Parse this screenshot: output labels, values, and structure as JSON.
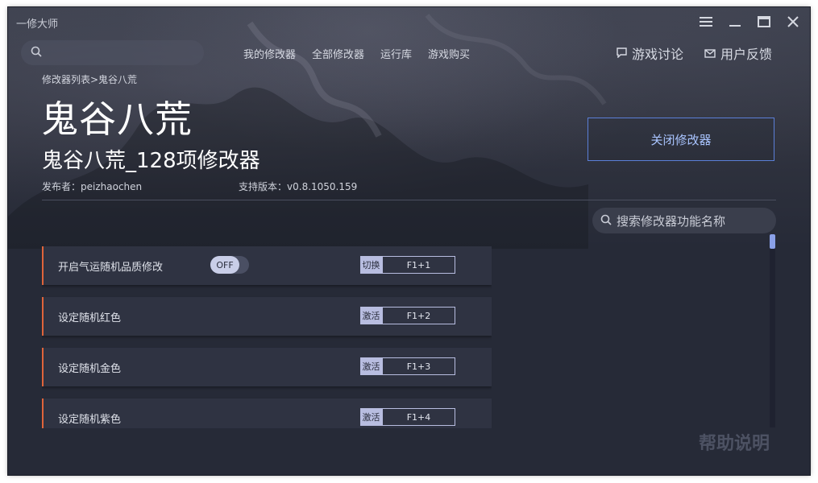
{
  "window": {
    "app_title": "一修大师"
  },
  "search": {
    "placeholder": ""
  },
  "nav": {
    "items": [
      "我的修改器",
      "全部修改器",
      "运行库",
      "游戏购买"
    ]
  },
  "header_links": {
    "discussion": "游戏讨论",
    "feedback": "用户反馈"
  },
  "breadcrumb": "修改器列表>鬼谷八荒",
  "game": {
    "title": "鬼谷八荒",
    "trainer_title": "鬼谷八荒_128项修改器",
    "publisher_label": "发布者：",
    "publisher": "peizhaochen",
    "version_label": "支持版本：",
    "version": "v0.8.1050.159",
    "close_button": "关闭修改器"
  },
  "feature_search": {
    "placeholder": "搜索修改器功能名称"
  },
  "features": [
    {
      "label": "开启气运随机品质修改",
      "toggle": "OFF",
      "action": "切换",
      "hotkey": "F1+1"
    },
    {
      "label": "设定随机红色",
      "action": "激活",
      "hotkey": "F1+2"
    },
    {
      "label": "设定随机金色",
      "action": "激活",
      "hotkey": "F1+3"
    },
    {
      "label": "设定随机紫色",
      "action": "激活",
      "hotkey": "F1+4"
    }
  ],
  "help": "帮助说明",
  "colors": {
    "accent": "#e0643a",
    "link_blue": "#5b7fd8",
    "background": "#262a37"
  }
}
